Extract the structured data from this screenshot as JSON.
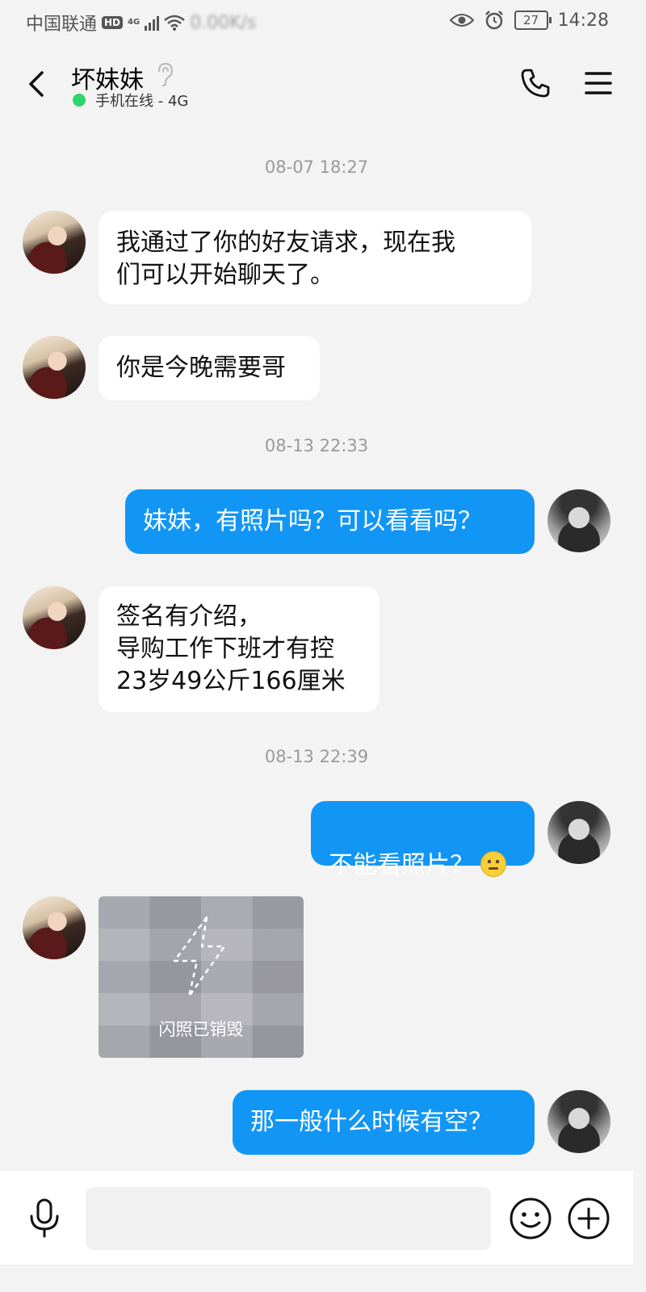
{
  "status_bar": {
    "carrier": "中国联通",
    "hd": "HD",
    "network": "4G",
    "speed": "0.00K/s",
    "battery": "27",
    "time": "14:28"
  },
  "header": {
    "contact_name": "坏妹妹",
    "online_status": "手机在线 - 4G"
  },
  "messages": {
    "ts1": "08-07 18:27",
    "m1": "我通过了你的好友请求，现在我\n们可以开始聊天了。",
    "m2": "你是今晚需要哥",
    "ts2": "08-13 22:33",
    "m3": "妹妹，有照片吗？可以看看吗？",
    "m4": "签名有介绍，\n导购工作下班才有控\n23岁49公斤166厘米",
    "ts3": "08-13 22:39",
    "m5": "不能看照片？",
    "m6_flash": "闪照已销毁",
    "m7": "那一般什么时候有空？"
  },
  "input": {
    "placeholder": ""
  },
  "colors": {
    "outgoing_bubble": "#1296f6",
    "incoming_bubble": "#ffffff",
    "background": "#f3f3f3",
    "online_dot": "#2fd46b"
  },
  "icons": {
    "back": "back-arrow-icon",
    "ear": "ear-icon",
    "phone": "phone-icon",
    "menu": "menu-icon",
    "mic": "microphone-icon",
    "emoji": "emoji-icon",
    "plus": "plus-icon",
    "flash": "lightning-icon",
    "sad_emoji": "sad-face-emoji"
  }
}
